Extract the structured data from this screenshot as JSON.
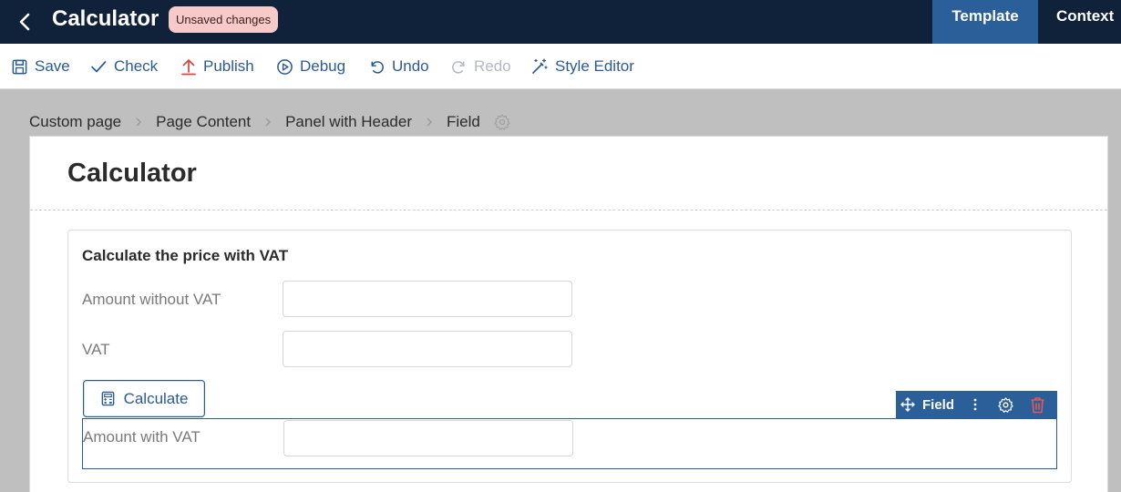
{
  "header": {
    "title": "Calculator",
    "badge": "Unsaved changes",
    "tabs": [
      {
        "label": "Template",
        "active": true
      },
      {
        "label": "Context",
        "active": false
      }
    ]
  },
  "toolbar": {
    "save": "Save",
    "check": "Check",
    "publish": "Publish",
    "debug": "Debug",
    "undo": "Undo",
    "redo": "Redo",
    "style_editor": "Style Editor"
  },
  "breadcrumb": [
    "Custom page",
    "Page Content",
    "Panel with Header",
    "Field"
  ],
  "page": {
    "title": "Calculator",
    "panel": {
      "header": "Calculate the price with VAT",
      "fields": [
        {
          "label": "Amount without VAT",
          "value": ""
        },
        {
          "label": "VAT",
          "value": ""
        },
        {
          "label": "Amount with VAT",
          "value": ""
        }
      ],
      "calculate_button": "Calculate"
    },
    "field_toolbar": {
      "label": "Field"
    }
  },
  "colors": {
    "topbar": "#10213a",
    "accent": "#2b5f9a",
    "link": "#2a5b93",
    "badge_bg": "#f7c9c9",
    "delete": "#e05a5a"
  }
}
